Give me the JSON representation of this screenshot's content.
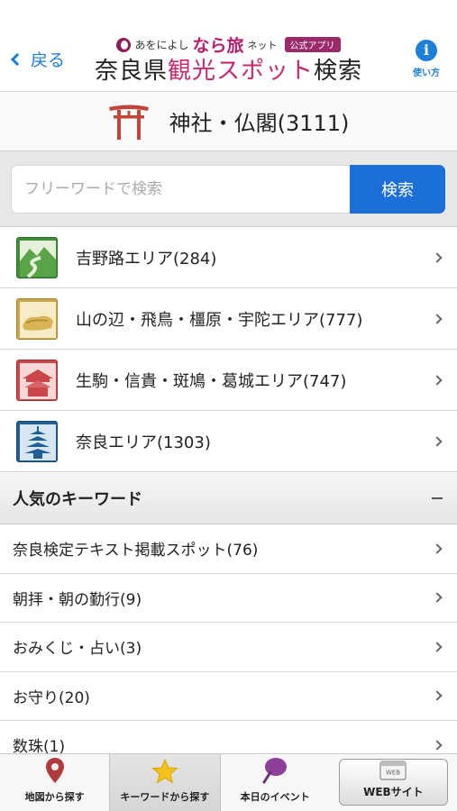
{
  "header": {
    "back_label": "戻る",
    "brand_prefix": "あをによし",
    "brand_emphasis": "なら旅",
    "brand_suffix": "ネット",
    "brand_badge": "公式アプリ",
    "title_part1": "奈良県",
    "title_accent": "観光スポット",
    "title_part2": "検索",
    "help_symbol": "i",
    "help_label": "使い方"
  },
  "category": {
    "title": "神社・仏閣(3111)",
    "icon": "torii-gate-icon"
  },
  "search": {
    "placeholder": "フリーワードで検索",
    "value": "",
    "button_label": "検索"
  },
  "areas": [
    {
      "label": "吉野路エリア(284)",
      "icon": "yoshino-mountain-icon",
      "color": "#3f8f3a"
    },
    {
      "label": "山の辺・飛鳥・橿原・宇陀エリア(777)",
      "icon": "asuka-stone-icon",
      "color": "#c9a44a"
    },
    {
      "label": "生駒・信貴・斑鳩・葛城エリア(747)",
      "icon": "ikoma-temple-icon",
      "color": "#c9464b"
    },
    {
      "label": "奈良エリア(1303)",
      "icon": "nara-pagoda-icon",
      "color": "#1f5f95"
    }
  ],
  "keywords": {
    "header": "人気のキーワード",
    "items": [
      {
        "label": "奈良検定テキスト掲載スポット(76)"
      },
      {
        "label": "朝拝・朝の勤行(9)"
      },
      {
        "label": "おみくじ・占い(3)"
      },
      {
        "label": "お守り(20)"
      },
      {
        "label": "数珠(1)"
      }
    ]
  },
  "tabbar": {
    "tabs": [
      {
        "label": "地図から探す",
        "icon": "map-pin-icon"
      },
      {
        "label": "キーワードから探す",
        "icon": "star-icon",
        "active": true
      },
      {
        "label": "本日のイベント",
        "icon": "uchiwa-fan-icon"
      },
      {
        "label": "WEBサイト",
        "icon": "web-browser-icon"
      }
    ]
  },
  "colors": {
    "accent_blue": "#1e7fd8",
    "search_button": "#1c6fd6",
    "brand_magenta": "#c8286e",
    "torii_red": "#c2453a"
  }
}
